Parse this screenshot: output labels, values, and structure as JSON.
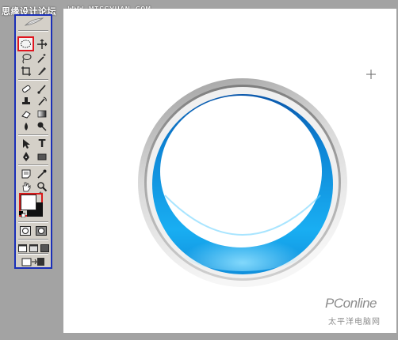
{
  "header": {
    "site_title": "思缘设计论坛",
    "url": "WWW.MISSYUAN.COM"
  },
  "toolbox": {
    "active_tool": "elliptical-marquee",
    "tools": [
      "elliptical-marquee",
      "move",
      "lasso",
      "magic-wand",
      "crop",
      "slice",
      "healing-brush",
      "brush",
      "clone-stamp",
      "history-brush",
      "eraser",
      "gradient",
      "blur",
      "dodge",
      "path-selection",
      "type",
      "pen",
      "rectangle",
      "notes",
      "eyedropper",
      "hand",
      "zoom"
    ],
    "type_tool_glyph": "T",
    "foreground_color": "#ffffff",
    "background_color": "#000000"
  },
  "canvas": {
    "background": "#ffffff",
    "ring": {
      "outer_colors": [
        "#f2f2f2",
        "#9a9a9a"
      ],
      "blue_colors": [
        "#0b5fb8",
        "#12a4ee",
        "#58ccff"
      ],
      "inner_color": "#ffffff"
    }
  },
  "watermark": {
    "brand": "PConline",
    "subtitle": "太平洋电脑网"
  },
  "colors": {
    "frame_border": "#1a2fb8",
    "highlight_border": "#e0141e"
  }
}
